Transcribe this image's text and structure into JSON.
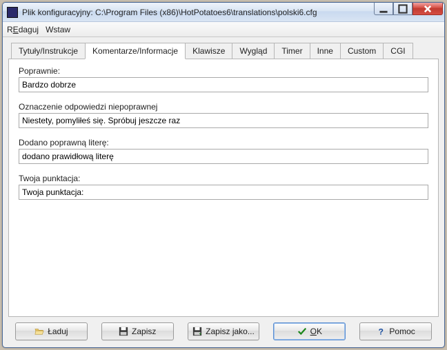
{
  "titlebar": {
    "text": "Plik konfiguracyjny: C:\\Program Files (x86)\\HotPotatoes6\\translations\\polski6.cfg"
  },
  "menu": {
    "edit_prefix": "R",
    "edit_mnem": "E",
    "edit_rest": "daguj",
    "insert": "Wstaw"
  },
  "tabs": [
    {
      "label": "Tytuły/Instrukcje"
    },
    {
      "label": "Komentarze/Informacje"
    },
    {
      "label": "Klawisze"
    },
    {
      "label": "Wygląd"
    },
    {
      "label": "Timer"
    },
    {
      "label": "Inne"
    },
    {
      "label": "Custom"
    },
    {
      "label": "CGI"
    }
  ],
  "active_tab": 1,
  "fields": {
    "correct_label": "Poprawnie:",
    "correct_value": "Bardzo dobrze",
    "incorrect_label": "Oznaczenie odpowiedzi niepoprawnej",
    "incorrect_value": "Niestety, pomyliłeś się. Spróbuj jeszcze raz",
    "added_letter_label": "Dodano poprawną literę:",
    "added_letter_value": "dodano prawidłową literę",
    "score_label": "Twoja punktacja:",
    "score_value": "Twoja punktacja:"
  },
  "buttons": {
    "load": "Ładuj",
    "save": "Zapisz",
    "saveas": "Zapisz jako...",
    "ok_mnem": "O",
    "ok_rest": "K",
    "help": "Pomoc"
  }
}
